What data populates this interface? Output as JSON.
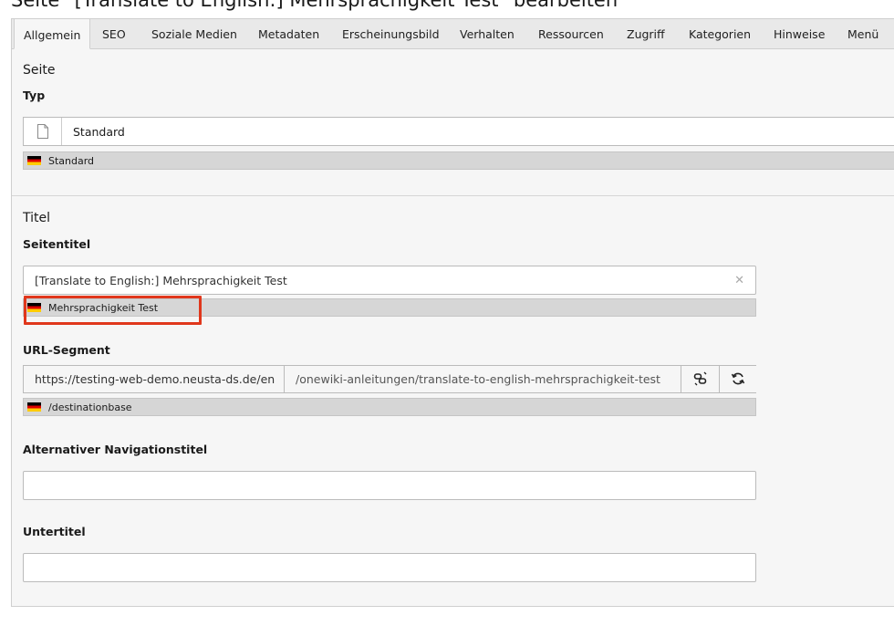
{
  "page_title": "Seite \"[Translate to English:] Mehrsprachigkeit Test\" bearbeiten",
  "tabs": [
    {
      "label": "Allgemein",
      "active": true
    },
    {
      "label": "SEO"
    },
    {
      "label": "Soziale Medien"
    },
    {
      "label": "Metadaten"
    },
    {
      "label": "Erscheinungsbild"
    },
    {
      "label": "Verhalten"
    },
    {
      "label": "Ressourcen"
    },
    {
      "label": "Zugriff"
    },
    {
      "label": "Kategorien"
    },
    {
      "label": "Hinweise"
    },
    {
      "label": "Menü"
    }
  ],
  "section_page": {
    "heading": "Seite",
    "type_label": "Typ",
    "type_value": "Standard",
    "type_icon": "document-icon",
    "type_default_hint": "Standard"
  },
  "section_title": {
    "heading": "Titel",
    "page_title_label": "Seitentitel",
    "page_title_value": "[Translate to English:] Mehrsprachigkeit Test",
    "page_title_default_hint": "Mehrsprachigkeit Test",
    "url_label": "URL-Segment",
    "url_prefix": "https://testing-web-demo.neusta-ds.de/en",
    "url_path": "/onewiki-anleitungen/translate-to-english-mehrsprachigkeit-test",
    "url_default_hint": "/destinationbase",
    "nav_title_label": "Alternativer Navigationstitel",
    "nav_title_value": "",
    "subtitle_label": "Untertitel",
    "subtitle_value": ""
  },
  "colors": {
    "highlight": "#e0371c",
    "hint_bar": "#d6d6d6",
    "panel_bg": "#f6f6f6"
  }
}
